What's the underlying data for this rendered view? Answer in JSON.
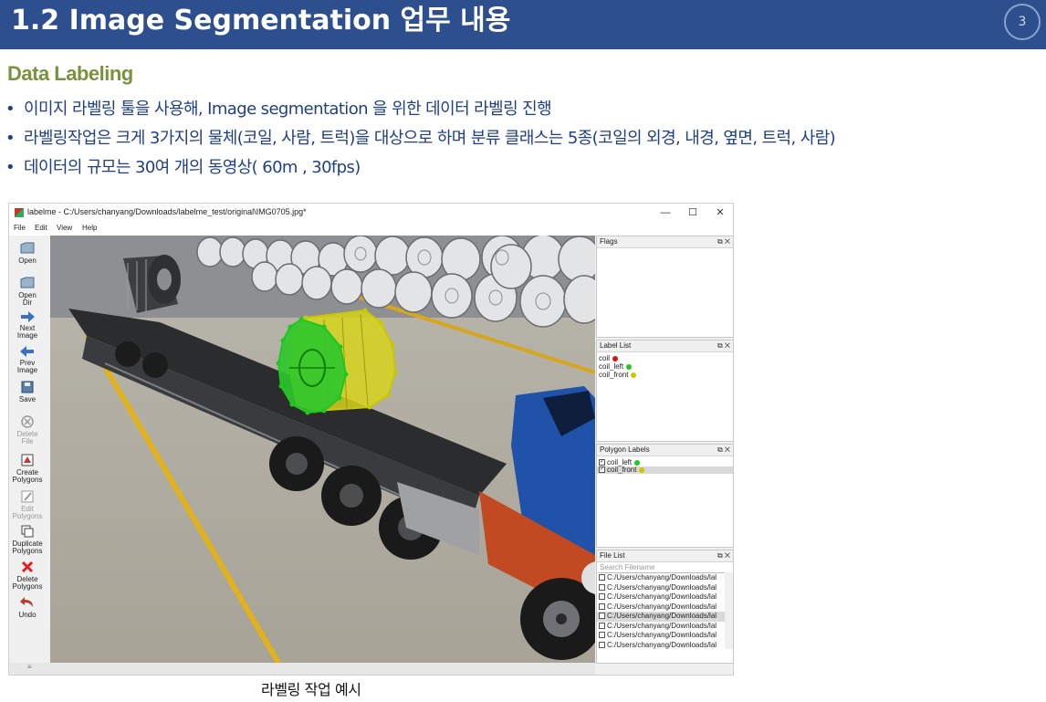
{
  "slide": {
    "title": "1.2 Image Segmentation 업무 내용",
    "page_number": "3",
    "section_heading": "Data Labeling",
    "bullets": [
      "이미지 라벨링 툴을 사용해,  Image segmentation 을 위한 데이터 라벨링 진행",
      "라벨링작업은 크게 3가지의 물체(코일, 사람, 트럭)을 대상으로 하며 분류 클래스는 5종(코일의 외경, 내경, 옆면, 트럭, 사람)",
      "데이터의 규모는 30여 개의 동영상( 60m , 30fps)"
    ],
    "caption": "라벨링 작업 예시",
    "colors": {
      "title_bar": "#2d4f8e",
      "section": "#77933c",
      "bullet_text": "#1f3f86"
    }
  },
  "app": {
    "window_title": "labelme - C:/Users/chanyang/Downloads/labelme_test/original\\IMG0705.jpg*",
    "window_controls": {
      "minimize": "—",
      "maximize": "☐",
      "close": "✕"
    },
    "menu": [
      "File",
      "Edit",
      "View",
      "Help"
    ],
    "tools": [
      {
        "line1": "Open",
        "line2": "",
        "line3": "",
        "icon": "folder-icon",
        "enabled": true
      },
      {
        "line1": "Open",
        "line2": "Dir",
        "line3": "",
        "icon": "folder-icon",
        "enabled": true
      },
      {
        "line1": "Next",
        "line2": "Image",
        "line3": "",
        "icon": "arrow-right-icon",
        "enabled": true
      },
      {
        "line1": "Prev",
        "line2": "Image",
        "line3": "",
        "icon": "arrow-left-icon",
        "enabled": true
      },
      {
        "line1": "Save",
        "line2": "",
        "line3": "",
        "icon": "save-icon",
        "enabled": true
      },
      {
        "line1": "Delete",
        "line2": "File",
        "line3": "",
        "icon": "delete-file-icon",
        "enabled": false
      },
      {
        "line1": "Create",
        "line2": "Polygons",
        "line3": "",
        "icon": "create-polygon-icon",
        "enabled": true
      },
      {
        "line1": "Edit",
        "line2": "Polygons",
        "line3": "",
        "icon": "edit-icon",
        "enabled": false
      },
      {
        "line1": "Duplicate",
        "line2": "Polygons",
        "line3": "",
        "icon": "duplicate-icon",
        "enabled": true
      },
      {
        "line1": "Delete",
        "line2": "Polygons",
        "line3": "",
        "icon": "delete-icon",
        "enabled": true
      },
      {
        "line1": "Undo",
        "line2": "",
        "line3": "",
        "icon": "undo-icon",
        "enabled": true
      }
    ],
    "docks": {
      "flags": {
        "title": "Flags"
      },
      "label_list": {
        "title": "Label List",
        "items": [
          {
            "label": "coil",
            "color": "#e01010"
          },
          {
            "label": "coil_left",
            "color": "#22c522"
          },
          {
            "label": "coil_front",
            "color": "#c8c800"
          }
        ]
      },
      "polygon_labels": {
        "title": "Polygon Labels",
        "items": [
          {
            "label": "coil_left",
            "color": "#22c522",
            "checked": true
          },
          {
            "label": "coil_front",
            "color": "#c8c800",
            "checked": true
          }
        ]
      },
      "file_list": {
        "title": "File List",
        "search_placeholder": "Search Filename",
        "files": [
          "C:/Users/chanyang/Downloads/lal",
          "C:/Users/chanyang/Downloads/lal",
          "C:/Users/chanyang/Downloads/lal",
          "C:/Users/chanyang/Downloads/lal",
          "C:/Users/chanyang/Downloads/lal",
          "C:/Users/chanyang/Downloads/lal",
          "C:/Users/chanyang/Downloads/lal",
          "C:/Users/chanyang/Downloads/lal"
        ]
      },
      "dock_buttons": {
        "float": "⧉",
        "close": "✕"
      }
    }
  }
}
